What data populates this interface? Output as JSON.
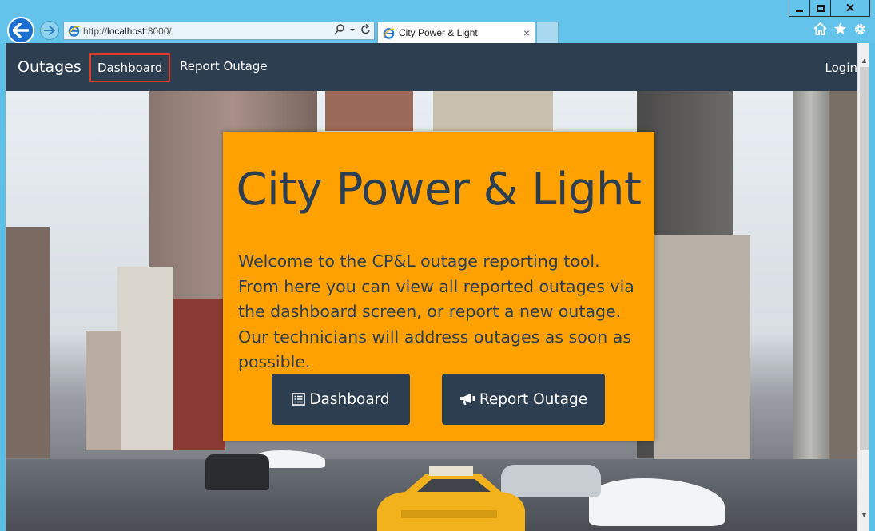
{
  "browser": {
    "url_prefix": "http://",
    "url_host": "localhost",
    "url_rest": ":3000/",
    "tab_title": "City Power & Light",
    "tab_close": "×",
    "win_close": "✕"
  },
  "navbar": {
    "brand": "Outages",
    "links": [
      "Dashboard",
      "Report Outage"
    ],
    "active_link": "Dashboard",
    "login": "Login"
  },
  "hero": {
    "title": "City Power & Light",
    "description": "Welcome to the CP&L outage reporting tool. From here you can view all reported outages via the dashboard screen, or report a new outage. Our technicians will address outages as soon as possible.",
    "buttons": {
      "dashboard": "Dashboard",
      "report": "Report Outage"
    }
  },
  "colors": {
    "navbar": "#2c3e50",
    "jumbotron": "#ffa100",
    "active_outline": "#e03a28"
  },
  "icons": {
    "dashboard_button": "list-icon",
    "report_button": "bullhorn-icon"
  }
}
